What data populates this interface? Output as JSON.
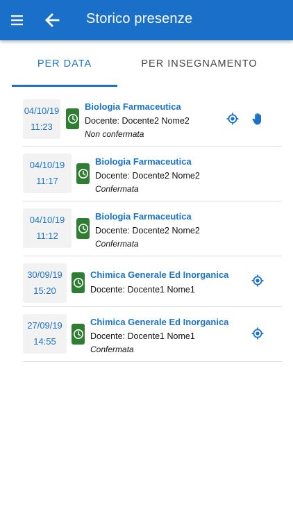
{
  "app_bar": {
    "title": "Storico presenze",
    "background": "#1a6fc8"
  },
  "tabs": [
    {
      "label": "PER DATA",
      "active": true
    },
    {
      "label": "PER INSEGNAMENTO",
      "active": false
    }
  ],
  "colors": {
    "accent": "#1a73c9",
    "clock_badge": "#2e7d32",
    "date_box_bg": "#f2f2f2"
  },
  "records": [
    {
      "date": "04/10/19",
      "time": "11:23",
      "course": "Biologia Farmaceutica",
      "teacher": "Docente: Docente2 Nome2",
      "status": "Non confermata",
      "icons": [
        "location-target-icon",
        "hand-icon"
      ]
    },
    {
      "date": "04/10/19",
      "time": "11:17",
      "course": "Biologia Farmaceutica",
      "teacher": "Docente: Docente2 Nome2",
      "status": "Confermata",
      "icons": []
    },
    {
      "date": "04/10/19",
      "time": "11:12",
      "course": "Biologia Farmaceutica",
      "teacher": "Docente: Docente2 Nome2",
      "status": "Confermata",
      "icons": []
    },
    {
      "date": "30/09/19",
      "time": "15:20",
      "course": "Chimica Generale Ed Inorganica",
      "teacher": "Docente: Docente1 Nome1",
      "status": "",
      "icons": [
        "location-target-icon"
      ]
    },
    {
      "date": "27/09/19",
      "time": "14:55",
      "course": "Chimica Generale Ed Inorganica",
      "teacher": "Docente: Docente1 Nome1",
      "status": "Confermata",
      "icons": [
        "location-target-icon"
      ]
    }
  ]
}
